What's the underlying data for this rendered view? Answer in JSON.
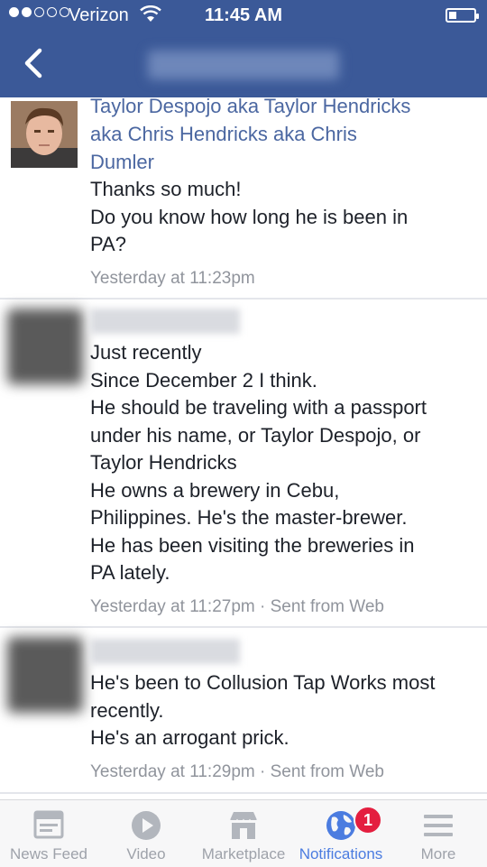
{
  "status_bar": {
    "carrier": "Verizon",
    "time": "11:45 AM"
  },
  "comments": [
    {
      "name": "Taylor Despojo aka Taylor Hendricks aka Chris Hendricks aka Chris Dumler",
      "name_lines": [
        "Taylor Despojo aka Taylor Hendricks",
        "aka Chris Hendricks aka Chris",
        "Dumler"
      ],
      "lines": [
        "Thanks so much!",
        "Do you know how long he is been in",
        "PA?"
      ],
      "meta": "Yesterday at 11:23pm"
    },
    {
      "lines": [
        "Just recently",
        "Since December 2 I think.",
        "He should be traveling with a passport",
        "under his name, or Taylor Despojo, or",
        "Taylor Hendricks",
        "He owns a brewery in Cebu,",
        "Philippines. He's the master-brewer.",
        "He has been visiting the breweries in",
        "PA lately."
      ],
      "meta": "Yesterday at 11:27pm · Sent from Web"
    },
    {
      "lines": [
        "He's been to Collusion Tap Works most",
        "recently.",
        "He's an arrogant prick."
      ],
      "meta": "Yesterday at 11:29pm · Sent from Web"
    }
  ],
  "tabs": [
    {
      "label": "News Feed",
      "icon": "news-feed-icon"
    },
    {
      "label": "Video",
      "icon": "video-play-icon"
    },
    {
      "label": "Marketplace",
      "icon": "marketplace-store-icon"
    },
    {
      "label": "Notifications",
      "icon": "globe-icon",
      "badge": "1",
      "active": true
    },
    {
      "label": "More",
      "icon": "menu-icon"
    }
  ],
  "colors": {
    "header": "#3b5998",
    "link": "#4b67a1",
    "active_tab": "#4b7ce0",
    "badge": "#e41e3f"
  }
}
